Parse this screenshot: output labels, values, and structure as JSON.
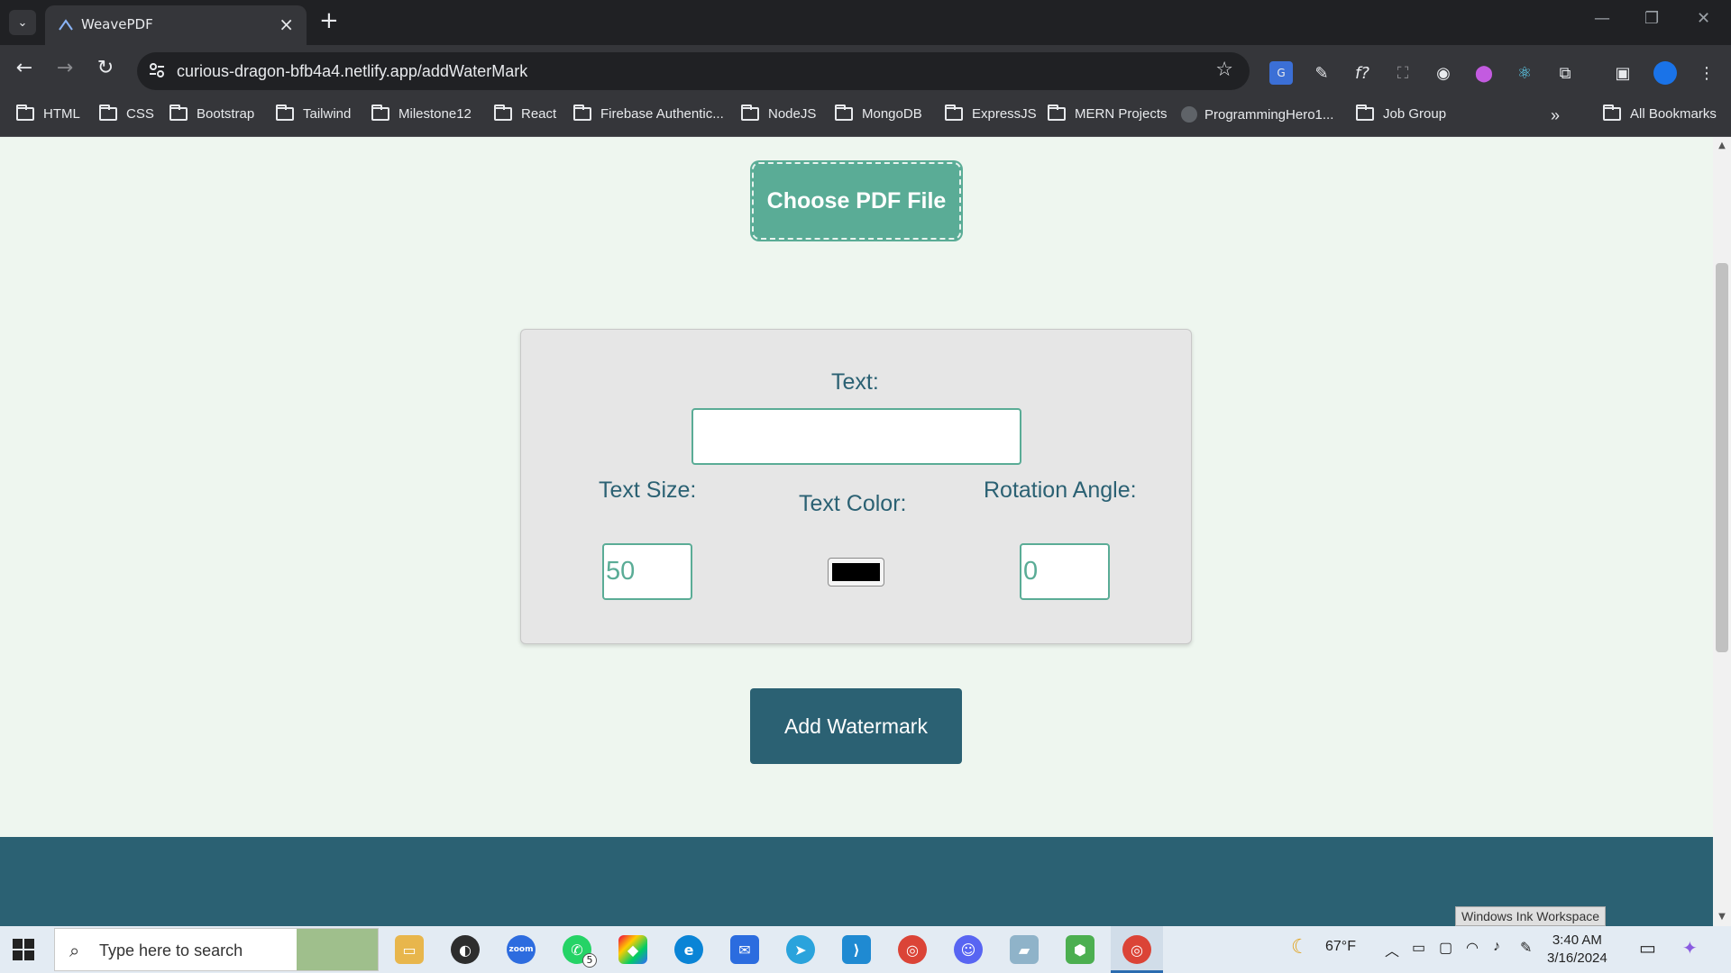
{
  "browser": {
    "tab_title": "WeavePDF",
    "url": "curious-dragon-bfb4a4.netlify.app/addWaterMark",
    "bookmarks": [
      {
        "label": "HTML",
        "icon": "folder-icon"
      },
      {
        "label": "CSS",
        "icon": "folder-icon"
      },
      {
        "label": "Bootstrap",
        "icon": "folder-icon"
      },
      {
        "label": "Tailwind",
        "icon": "folder-icon"
      },
      {
        "label": "Milestone12",
        "icon": "folder-icon"
      },
      {
        "label": "React",
        "icon": "folder-icon"
      },
      {
        "label": "Firebase Authentic...",
        "icon": "folder-icon"
      },
      {
        "label": "NodeJS",
        "icon": "folder-icon"
      },
      {
        "label": "MongoDB",
        "icon": "folder-icon"
      },
      {
        "label": "ExpressJS",
        "icon": "folder-icon"
      },
      {
        "label": "MERN Projects",
        "icon": "folder-icon"
      },
      {
        "label": "ProgrammingHero1...",
        "icon": "github-icon"
      },
      {
        "label": "Job Group",
        "icon": "folder-icon"
      }
    ],
    "more_bookmarks": "»",
    "all_bookmarks": "All Bookmarks"
  },
  "page": {
    "choose_pdf_label": "Choose PDF File",
    "text_label": "Text:",
    "text_value": "",
    "text_size_label": "Text Size:",
    "text_size_value": "50",
    "text_color_label": "Text Color:",
    "text_color_value": "#000000",
    "rotation_label": "Rotation Angle:",
    "rotation_value": "0",
    "add_watermark_label": "Add Watermark",
    "colors": {
      "accent": "#5aac96",
      "primary": "#2b6173",
      "background": "#eef6ef",
      "panel": "#e6e6e6"
    }
  },
  "tooltip": "Windows Ink Workspace",
  "taskbar": {
    "search_placeholder": "Type here to search",
    "whatsapp_badge": "5",
    "weather_temp": "67°F",
    "time": "3:40 AM",
    "date": "3/16/2024"
  }
}
